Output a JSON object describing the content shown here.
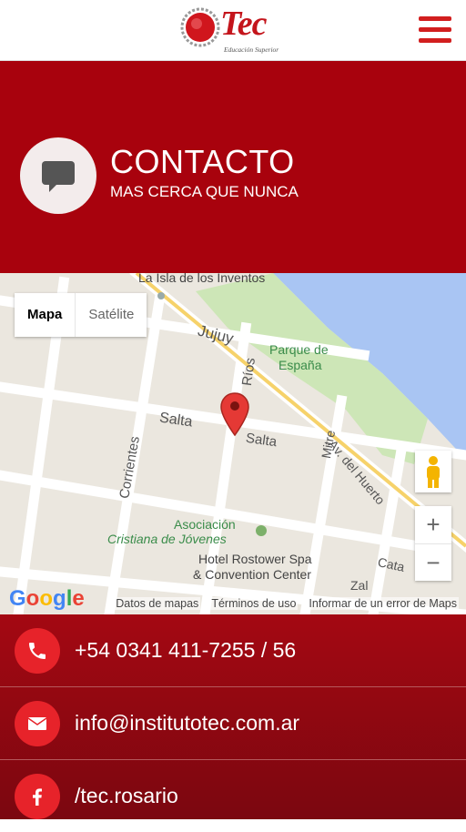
{
  "header": {
    "logo_text": "Tec",
    "logo_subtitle": "Educación Superior"
  },
  "hero": {
    "title": "CONTACTO",
    "subtitle": "MAS CERCA QUE NUNCA",
    "icon": "chat-bubble-icon"
  },
  "map": {
    "type_buttons": [
      "Mapa",
      "Satélite"
    ],
    "selected_type": "Mapa",
    "labels": {
      "poi1": "La Isla de los Inventos",
      "street_jujuy": "Jujuy",
      "park_1": "Parque de",
      "park_2": "España",
      "street_rios": "Ríos",
      "street_salta_1": "Salta",
      "street_salta_2": "Salta",
      "street_mitre": "Mitre",
      "street_av": "Av. del Huerto",
      "street_corrientes": "Corrientes",
      "poi2_1": "Asociación",
      "poi2_2": "Cristiana de Jóvenes",
      "hotel_1": "Hotel Rostower Spa",
      "hotel_2": "& Convention Center",
      "street_cata": "Cata",
      "street_zal": "Zal"
    },
    "zoom_in": "+",
    "zoom_out": "−",
    "footer_links": [
      "Datos de mapas",
      "Términos de uso",
      "Informar de un error de Maps"
    ],
    "google_logo": "Google"
  },
  "contacts": [
    {
      "icon": "phone-icon",
      "text": "+54 0341 411-7255 / 56"
    },
    {
      "icon": "mail-icon",
      "text": "info@institutotec.com.ar"
    },
    {
      "icon": "facebook-icon",
      "text": "/tec.rosario"
    }
  ],
  "colors": {
    "brand_red": "#c4151c",
    "hero_bg": "#a8020d",
    "icon_circle": "#e7232a",
    "water": "#a9c5f3",
    "park": "#cde6b7"
  }
}
